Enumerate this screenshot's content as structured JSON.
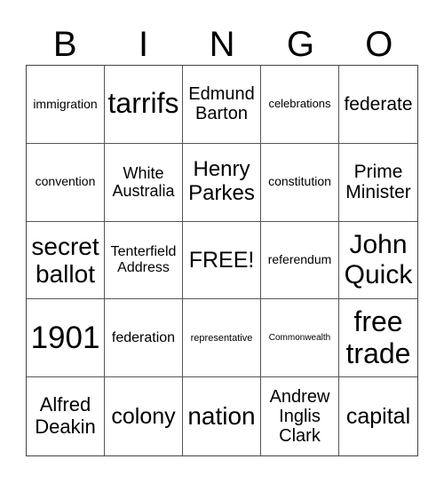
{
  "header": {
    "letters": [
      "B",
      "I",
      "N",
      "G",
      "O"
    ]
  },
  "cells": [
    "immigration",
    "tarrifs",
    "Edmund Barton",
    "celebrations",
    "federate",
    "convention",
    "White Australia",
    "Henry Parkes",
    "constitution",
    "Prime Minister",
    "secret ballot",
    "Tenterfield Address",
    "FREE!",
    "referendum",
    "John Quick",
    "1901",
    "federation",
    "representative",
    "Commonwealth",
    "free trade",
    "Alfred Deakin",
    "colony",
    "nation",
    "Andrew Inglis Clark",
    "capital"
  ]
}
